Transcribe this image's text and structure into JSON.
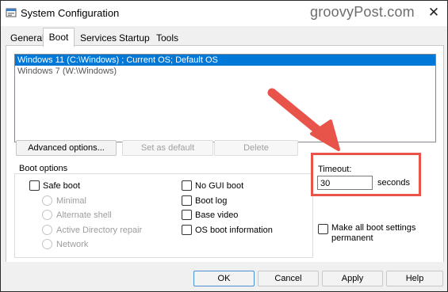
{
  "window": {
    "title": "System Configuration",
    "watermark": "groovyPost.com",
    "close": "✕"
  },
  "tabs": [
    {
      "label": "General",
      "active": false
    },
    {
      "label": "Boot",
      "active": true
    },
    {
      "label": "Services",
      "active": false
    },
    {
      "label": "Startup",
      "active": false
    },
    {
      "label": "Tools",
      "active": false
    }
  ],
  "os_list": [
    {
      "label": "Windows 11 (C:\\Windows) ; Current OS; Default OS",
      "selected": true
    },
    {
      "label": "Windows 7 (W:\\Windows)",
      "selected": false
    }
  ],
  "list_buttons": {
    "advanced": "Advanced options...",
    "set_default": "Set as default",
    "delete": "Delete"
  },
  "boot_options": {
    "group_label": "Boot options",
    "safe_boot": "Safe boot",
    "minimal": "Minimal",
    "alternate_shell": "Alternate shell",
    "ad_repair": "Active Directory repair",
    "network": "Network",
    "no_gui": "No GUI boot",
    "boot_log": "Boot log",
    "base_video": "Base video",
    "os_info": "OS boot information"
  },
  "timeout": {
    "label": "Timeout:",
    "value": "30",
    "unit": "seconds"
  },
  "permanent": "Make all boot settings permanent",
  "footer": {
    "ok": "OK",
    "cancel": "Cancel",
    "apply": "Apply",
    "help": "Help"
  },
  "colors": {
    "selection": "#0078d7",
    "annotation": "#e8534a"
  },
  "icons": [
    "msconfig-icon",
    "close-icon",
    "annotation-arrow"
  ]
}
